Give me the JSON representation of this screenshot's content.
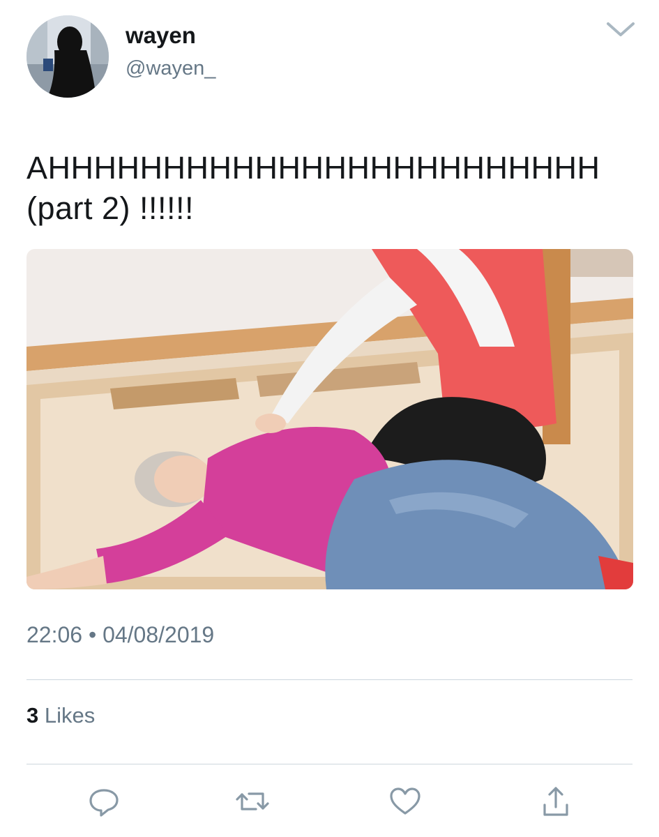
{
  "user": {
    "display_name": "wayen",
    "handle": "@wayen_",
    "avatar_icon": "avatar-silhouette"
  },
  "tweet": {
    "text": "AHHHHHHHHHHHHHHHHHHHHHHHH (part 2) !!!!!!",
    "time": "22:06",
    "separator": "•",
    "date": "04/08/2019"
  },
  "stats": {
    "likes_count": "3",
    "likes_label": "Likes"
  },
  "icons": {
    "menu": "chevron-down-icon",
    "reply": "reply-icon",
    "retweet": "retweet-icon",
    "like": "heart-icon",
    "share": "share-icon"
  },
  "colors": {
    "text": "#14171a",
    "secondary": "#657786",
    "divider": "#ccd6dd",
    "icon": "#8899a6"
  }
}
